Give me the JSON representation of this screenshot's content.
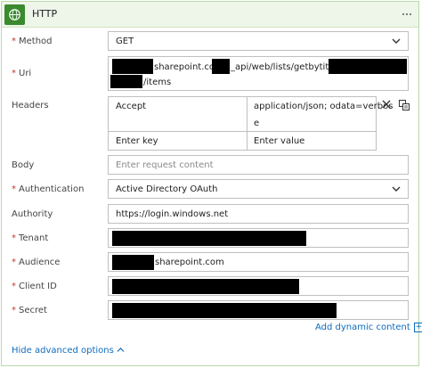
{
  "header": {
    "title": "HTTP",
    "icon": "globe-icon",
    "menu_icon": "more-options-icon"
  },
  "required_marker": "*",
  "method": {
    "label": "Method",
    "value": "GET"
  },
  "uri": {
    "label": "Uri",
    "part1": "sharepoint.com",
    "part2": "_api/web/lists/getbytitle('",
    "part3": "/items"
  },
  "headers": {
    "label": "Headers",
    "key": "Accept",
    "value_line1": "application/json; odata=verbos",
    "value_line2": "e",
    "key_placeholder": "Enter key",
    "value_placeholder": "Enter value"
  },
  "body": {
    "label": "Body",
    "placeholder": "Enter request content"
  },
  "authentication": {
    "label": "Authentication",
    "value": "Active Directory OAuth"
  },
  "authority": {
    "label": "Authority",
    "value": "https://login.windows.net"
  },
  "tenant": {
    "label": "Tenant"
  },
  "audience": {
    "label": "Audience",
    "value": "sharepoint.com"
  },
  "client_id": {
    "label": "Client ID"
  },
  "secret": {
    "label": "Secret"
  },
  "dynamic_content": {
    "label": "Add dynamic content",
    "plus": "+"
  },
  "advanced": {
    "label": "Hide advanced options"
  },
  "colors": {
    "header_bg": "#eef6e9",
    "icon_bg": "#3a8a2e",
    "required": "#c0392b",
    "link": "#0f6cbd",
    "redaction": "#000000"
  }
}
